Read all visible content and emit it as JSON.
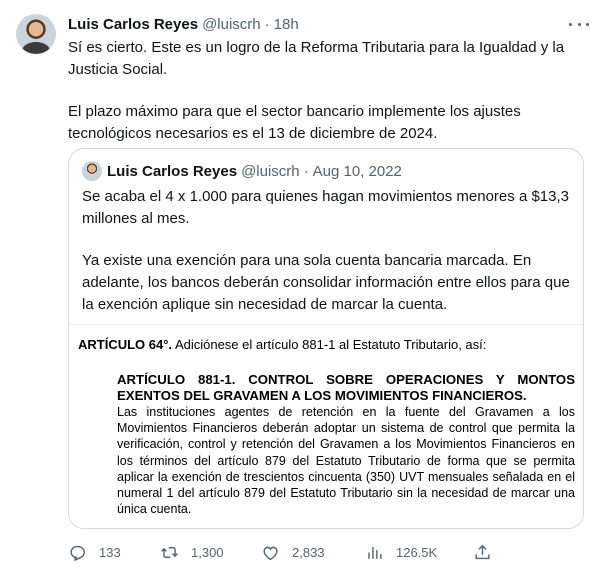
{
  "tweet": {
    "author_name": "Luis Carlos Reyes",
    "handle": "@luiscrh",
    "separator": "·",
    "time": "18h",
    "paragraphs": [
      "Sí es cierto. Este es un logro de la Reforma Tributaria para la Igualdad y la Justicia Social.",
      "El plazo máximo para que el sector bancario implemente los ajustes tecnológicos necesarios es el 13 de diciembre de 2024."
    ]
  },
  "quote": {
    "author_name": "Luis Carlos Reyes",
    "handle": "@luiscrh",
    "separator": "·",
    "date": "Aug 10, 2022",
    "paragraphs": [
      "Se acaba el 4 x 1.000 para quienes hagan movimientos menores a $13,3 millones al mes.",
      "Ya existe una exención para una sola cuenta bancaria marcada. En adelante, los bancos deberán consolidar información entre ellos para que la exención aplique sin necesidad de marcar la cuenta."
    ],
    "document": {
      "article_label": "ARTÍCULO 64°.",
      "article_intro": " Adiciónese el artículo 881-1 al Estatuto Tributario, así:",
      "sub_title": "ARTÍCULO 881-1. CONTROL SOBRE OPERACIONES Y MONTOS EXENTOS DEL GRAVAMEN A LOS MOVIMIENTOS FINANCIEROS.",
      "sub_body": "Las instituciones agentes de retención en la fuente del Gravamen a los Movimientos Financieros deberán adoptar un sistema de control que permita la verificación, control y retención del Gravamen a los Movimientos Financieros en los términos del artículo 879 del Estatuto Tributario de forma que se permita aplicar la exención de trescientos cincuenta (350) UVT mensuales señalada en el numeral 1 del artículo 879 del Estatuto Tributario sin la necesidad de marcar una única cuenta."
    }
  },
  "actions": {
    "replies": "133",
    "retweets": "1,300",
    "likes": "2,833",
    "views": "126.5K"
  },
  "icons": {
    "reply": "reply-icon",
    "retweet": "retweet-icon",
    "like": "heart-icon",
    "views": "views-icon",
    "share": "share-icon",
    "more": "more-icon"
  },
  "colors": {
    "text": "#0f1419",
    "secondary": "#536471",
    "border": "#cfd9de"
  }
}
